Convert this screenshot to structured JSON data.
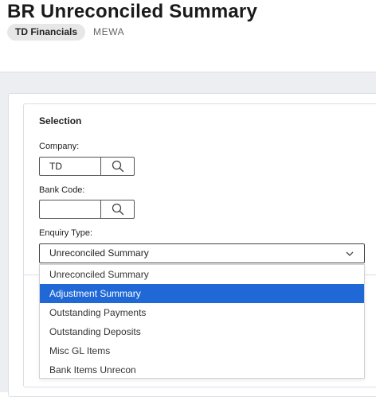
{
  "header": {
    "title": "BR Unreconciled Summary",
    "chip": "TD Financials",
    "crumb": "MEWA"
  },
  "selection": {
    "title": "Selection",
    "company": {
      "label": "Company:",
      "value": "TD"
    },
    "bank_code": {
      "label": "Bank Code:",
      "value": ""
    },
    "enquiry_type": {
      "label": "Enquiry Type:",
      "value": "Unreconciled Summary",
      "highlighted_option": "Adjustment Summary",
      "options": [
        "Unreconciled Summary",
        "Adjustment Summary",
        "Outstanding Payments",
        "Outstanding Deposits",
        "Misc GL Items",
        "Bank Items Unrecon"
      ]
    }
  },
  "icons": {
    "company_lookup": "search-icon",
    "bank_lookup": "search-icon",
    "select_toggle": "chevron-down-icon"
  },
  "colors": {
    "highlight": "#1f68d6",
    "page_bg": "#eceef1"
  }
}
